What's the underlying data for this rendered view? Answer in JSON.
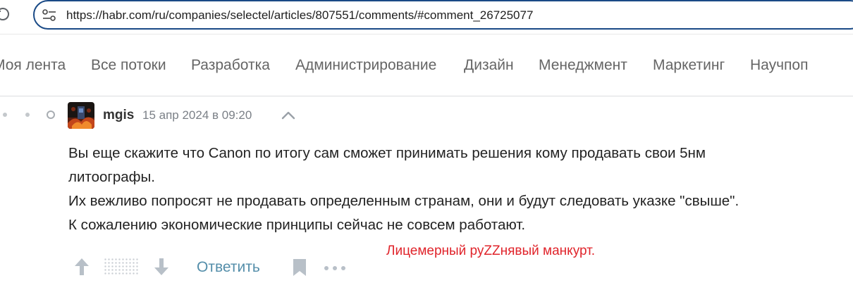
{
  "browser": {
    "url": "https://habr.com/ru/companies/selectel/articles/807551/comments/#comment_26725077"
  },
  "nav": {
    "items": [
      "Моя лента",
      "Все потоки",
      "Разработка",
      "Администрирование",
      "Дизайн",
      "Менеджмент",
      "Маркетинг",
      "Научпоп"
    ]
  },
  "comment": {
    "author": "mgis",
    "date": "15 апр 2024 в 09:20",
    "lines": [
      "Вы еще скажите что Canon по итогу сам сможет принимать решения кому продавать свои 5нм",
      "литоографы.",
      "Их вежливо попросят не продавать определенным странам, они и будут следовать указке \"свыше\".",
      "К сожалению экономические принципы сейчас не совсем работают."
    ],
    "reply_label": "Ответить"
  },
  "annotation": {
    "text": "Лицемерный руZZнявый манкурт.",
    "color": "#e0242b"
  },
  "colors": {
    "url_border": "#1a4a86",
    "nav_text": "#656565",
    "reply_link": "#548eaa",
    "icon_gray": "#b8c0c8"
  },
  "icons": [
    "reload-icon",
    "site-settings-icon",
    "chevron-up-icon",
    "arrow-up-icon",
    "arrow-down-icon",
    "bookmark-icon",
    "more-icon"
  ]
}
